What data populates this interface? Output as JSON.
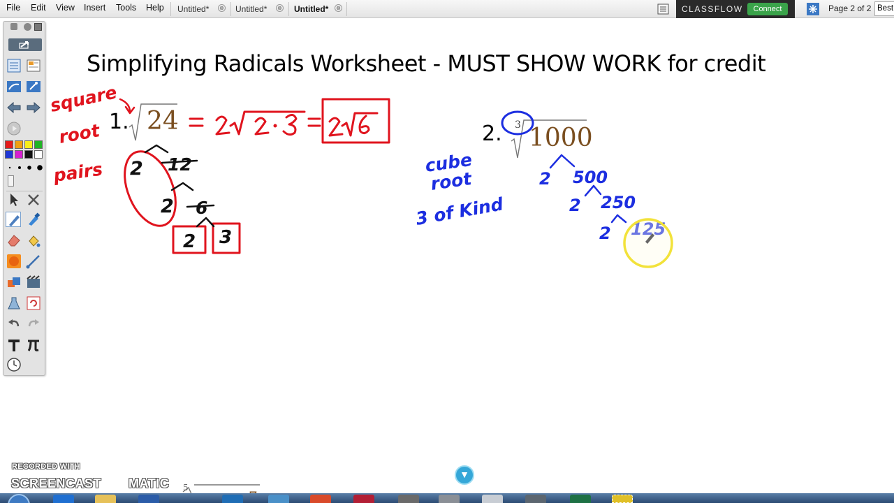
{
  "menu": {
    "file": "File",
    "edit": "Edit",
    "view": "View",
    "insert": "Insert",
    "tools": "Tools",
    "help": "Help"
  },
  "tabs": [
    {
      "label": "Untitled*",
      "active": false
    },
    {
      "label": "Untitled*",
      "active": false
    },
    {
      "label": "Untitled*",
      "active": true
    }
  ],
  "classflow": {
    "logo": "CLASSFLOW",
    "connect_label": "Connect"
  },
  "page_indicator": "Page 2 of 2",
  "zoom_select": "Best",
  "worksheet": {
    "title": "Simplifying Radicals Worksheet - MUST SHOW WORK for credit",
    "problem1": {
      "number": "1.",
      "radicand": "24"
    },
    "problem2": {
      "number": "2.",
      "index": "3",
      "radicand": "1000"
    }
  },
  "handwriting": {
    "square_root": [
      "square",
      "root"
    ],
    "pairs": "pairs",
    "cube_root": [
      "cube",
      "root"
    ],
    "three_of_kind": "3 of Kind",
    "equation": "= 2√2·3 =",
    "answer1": "2√6",
    "tree1": [
      "2",
      "12",
      "2",
      "6",
      "2",
      "3"
    ],
    "tree2": [
      "2",
      "500",
      "2",
      "250",
      "2",
      "125"
    ]
  },
  "watermark": {
    "line1": "RECORDED WITH",
    "line2": "SCREENCAST",
    "line3": "MATIC"
  },
  "colors": {
    "red_ink": "#e0141e",
    "blue_ink": "#1c2ee0",
    "radicand_brown": "#7a4e1f",
    "classflow_green": "#3aa34a",
    "cursor_highlight": "#f2e23a"
  },
  "icons": {
    "tab_close": "⊗",
    "scroll_down": "▼"
  }
}
